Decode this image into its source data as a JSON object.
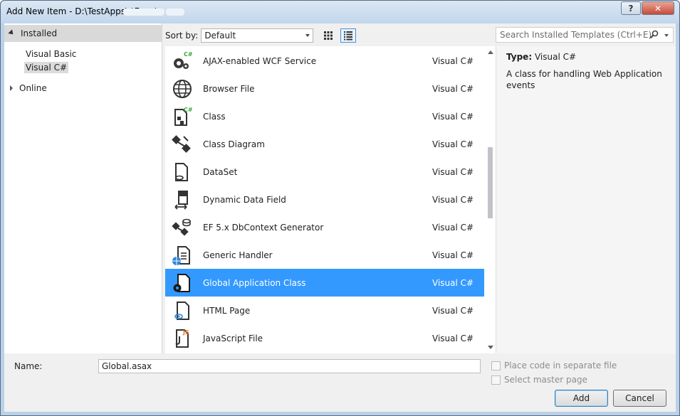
{
  "window": {
    "title": "Add New Item - D:\\TestApps\\            tError\\",
    "help_glyph": "?",
    "close_glyph": "✕"
  },
  "left_panel": {
    "installed_label": "Installed",
    "languages": [
      "Visual Basic",
      "Visual C#"
    ],
    "selected_language": "Visual C#",
    "online_label": "Online"
  },
  "sort": {
    "label": "Sort by:",
    "value": "Default"
  },
  "search": {
    "placeholder": "Search Installed Templates (Ctrl+E)"
  },
  "templates": [
    {
      "name": "AJAX-enabled WCF Service",
      "lang": "Visual C#",
      "icon": "wcf-service-icon"
    },
    {
      "name": "Browser File",
      "lang": "Visual C#",
      "icon": "browser-file-icon"
    },
    {
      "name": "Class",
      "lang": "Visual C#",
      "icon": "class-icon"
    },
    {
      "name": "Class Diagram",
      "lang": "Visual C#",
      "icon": "class-diagram-icon"
    },
    {
      "name": "DataSet",
      "lang": "Visual C#",
      "icon": "dataset-icon"
    },
    {
      "name": "Dynamic Data Field",
      "lang": "Visual C#",
      "icon": "dynamic-data-field-icon"
    },
    {
      "name": "EF 5.x DbContext Generator",
      "lang": "Visual C#",
      "icon": "ef-generator-icon"
    },
    {
      "name": "Generic Handler",
      "lang": "Visual C#",
      "icon": "generic-handler-icon"
    },
    {
      "name": "Global Application Class",
      "lang": "Visual C#",
      "icon": "global-application-class-icon"
    },
    {
      "name": "HTML Page",
      "lang": "Visual C#",
      "icon": "html-page-icon"
    },
    {
      "name": "JavaScript File",
      "lang": "Visual C#",
      "icon": "javascript-file-icon"
    }
  ],
  "selected_template": "Global Application Class",
  "details": {
    "type_label": "Type:",
    "type_value": "Visual C#",
    "description": "A class for handling Web Application events"
  },
  "bottom": {
    "name_label": "Name:",
    "name_value": "Global.asax",
    "place_code_label": "Place code in separate file",
    "master_page_label": "Select master page",
    "add_label": "Add",
    "cancel_label": "Cancel"
  },
  "colors": {
    "selection": "#3399ff",
    "title_bar": "#c2d6ec",
    "close_button": "#c64b38"
  }
}
